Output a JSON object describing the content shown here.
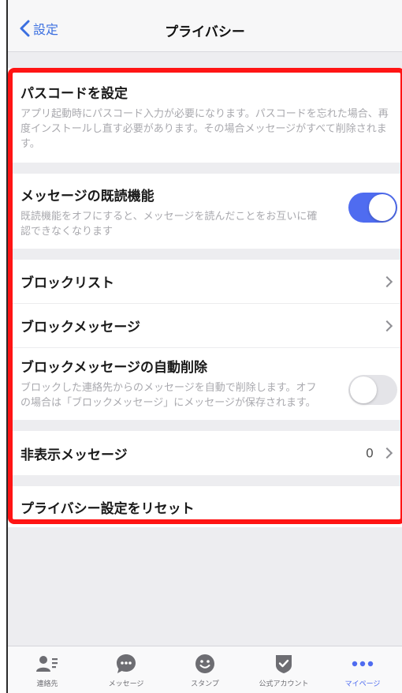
{
  "header": {
    "back_label": "設定",
    "title": "プライバシー"
  },
  "settings": {
    "passcode": {
      "title": "パスコードを設定",
      "description": "アプリ起動時にパスコード入力が必要になります。パスコードを忘れた場合、再度インストールし直す必要があります。その場合メッセージがすべて削除されます。"
    },
    "read_receipts": {
      "title": "メッセージの既読機能",
      "description": "既読機能をオフにすると、メッセージを読んだことをお互いに確認できなくなります",
      "enabled": true
    },
    "block_list": {
      "title": "ブロックリスト"
    },
    "block_messages": {
      "title": "ブロックメッセージ"
    },
    "auto_delete_blocked": {
      "title": "ブロックメッセージの自動削除",
      "description": "ブロックした連絡先からのメッセージを自動で削除します。オフの場合は「ブロックメッセージ」にメッセージが保存されます。",
      "enabled": false
    },
    "hidden_messages": {
      "title": "非表示メッセージ",
      "count": "0"
    },
    "reset": {
      "title": "プライバシー設定をリセット"
    }
  },
  "tabs": [
    {
      "label": "連絡先",
      "icon": "contacts-icon",
      "active": false
    },
    {
      "label": "メッセージ",
      "icon": "chat-bubble-icon",
      "active": false
    },
    {
      "label": "スタンプ",
      "icon": "smiley-icon",
      "active": false
    },
    {
      "label": "公式アカウント",
      "icon": "verified-shield-icon",
      "active": false
    },
    {
      "label": "マイページ",
      "icon": "more-dots-icon",
      "active": true
    }
  ],
  "colors": {
    "accent": "#4f6cf0",
    "link": "#3b6fe0",
    "highlight_border": "#ff1414",
    "tab_icon": "#6d6d72"
  }
}
